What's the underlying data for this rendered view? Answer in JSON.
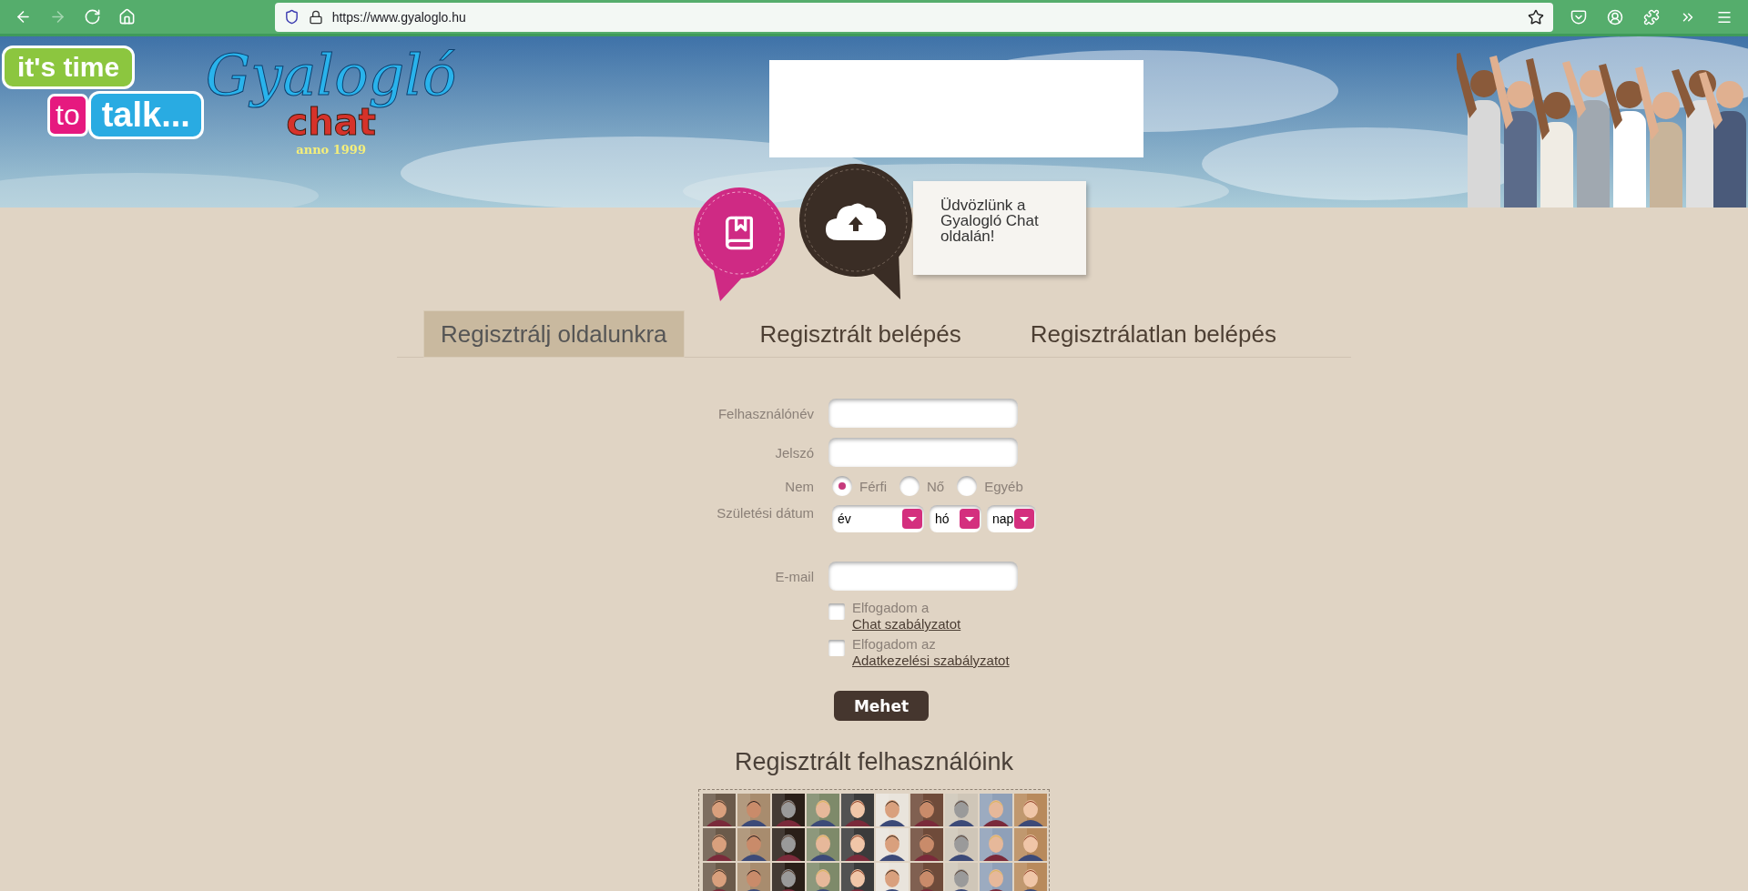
{
  "browser": {
    "buttons": [
      {
        "kind": "back",
        "disabled": false
      },
      {
        "kind": "forward",
        "disabled": true
      },
      {
        "kind": "reload",
        "disabled": false
      },
      {
        "kind": "home",
        "disabled": false
      }
    ],
    "url": "https://www.gyaloglo.hu",
    "tools": [
      {
        "kind": "pocket"
      },
      {
        "kind": "account"
      },
      {
        "kind": "extensions"
      },
      {
        "kind": "more"
      },
      {
        "kind": "menu"
      }
    ]
  },
  "header": {
    "logo": {
      "bubble_top": "it's time",
      "bubble_pink": "to",
      "bubble_blue": "talk...",
      "name": "Gyalogló",
      "chat": "chat",
      "since": "anno 1999"
    },
    "welcome": "Üdvözlünk a Gyalogló Chat oldalán!"
  },
  "tabs": [
    {
      "label": "Regisztrálj oldalunkra",
      "selected": true
    },
    {
      "label": "Regisztrált belépés",
      "selected": false
    },
    {
      "label": "Regisztrálatlan belépés",
      "selected": false
    }
  ],
  "form": {
    "username": {
      "label": "Felhasználónév"
    },
    "password": {
      "label": "Jelszó"
    },
    "gender": {
      "label": "Nem",
      "options": [
        {
          "label": "Férfi",
          "selected": true
        },
        {
          "label": "Nő",
          "selected": false
        },
        {
          "label": "Egyéb",
          "selected": false
        }
      ]
    },
    "birth_date": {
      "label": "Születési dátum",
      "selects": [
        {
          "value": "év"
        },
        {
          "value": "hó"
        },
        {
          "value": "nap"
        }
      ]
    },
    "email": {
      "label": "E-mail"
    },
    "consents": [
      {
        "text": "Elfogadom a",
        "link": "Chat szabályzatot",
        "checked": false
      },
      {
        "text": "Elfogadom az",
        "link": "Adatkezelési szabályzatot",
        "checked": false
      }
    ],
    "submit": "Mehet"
  },
  "members": {
    "title": "Regisztrált felhasználóink"
  }
}
